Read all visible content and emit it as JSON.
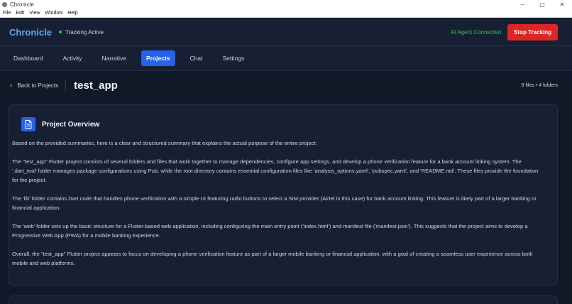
{
  "window": {
    "title": "Chronicle",
    "controls": [
      "–",
      "▢",
      "✕"
    ]
  },
  "menu": [
    "File",
    "Edit",
    "View",
    "Window",
    "Help"
  ],
  "header": {
    "brand": "Chronicle",
    "tracking_status": "Tracking Active",
    "agent_status": "AI Agent Connected",
    "stop_button": "Stop Tracking"
  },
  "tabs": [
    {
      "label": "Dashboard",
      "active": false
    },
    {
      "label": "Activity",
      "active": false
    },
    {
      "label": "Narrative",
      "active": false
    },
    {
      "label": "Projects",
      "active": true
    },
    {
      "label": "Chat",
      "active": false
    },
    {
      "label": "Settings",
      "active": false
    }
  ],
  "project": {
    "back_label": "Back to Projects",
    "name": "test_app",
    "counts": "9 files • 4 folders"
  },
  "overview": {
    "title": "Project Overview",
    "paragraphs": [
      "Based on the provided summaries, here is a clear and structured summary that explains the actual purpose of the entire project:",
      "The \"test_app\" Flutter project consists of several folders and files that work together to manage dependencies, configure app settings, and develop a phone verification feature for a bank account linking system. The '.dart_tool' folder manages package configurations using Pub, while the root directory contains essential configuration files like 'analysis_options.yaml', 'pubspec.yaml', and 'README.md'. These files provide the foundation for the project.",
      "The 'lib' folder contains Dart code that handles phone verification with a simple UI featuring radio buttons to select a SIM provider (Airtel in this case) for bank account linking. This feature is likely part of a larger banking or financial application.",
      "The 'web' folder sets up the basic structure for a Flutter-based web application, including configuring the main entry point ('index.html') and manifest file ('manifest.json'). This suggests that the project aims to develop a Progressive Web App (PWA) for a mobile banking experience.",
      "Overall, the \"test_app\" Flutter project appears to focus on developing a phone verification feature as part of a larger mobile banking or financial application, with a goal of creating a seamless user experience across both mobile and web platforms."
    ]
  },
  "colors": {
    "background": "#111827",
    "panel": "#172033",
    "accent": "#2563eb",
    "brand": "#60a5fa",
    "success": "#22c55e",
    "danger": "#dc2626"
  },
  "icons": {
    "back": "chevron-left-icon",
    "overview": "document-icon",
    "tracking": "status-dot-icon"
  }
}
